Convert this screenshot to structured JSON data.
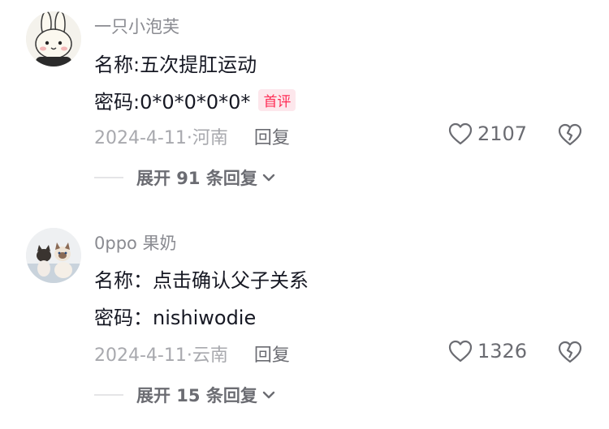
{
  "comments": [
    {
      "username": "一只小泡芙",
      "line1": "名称:五次提肛运动",
      "line2": "密码:0*0*0*0*0*",
      "badge": "首评",
      "meta": "2024-4-11·河南",
      "reply_label": "回复",
      "likes": "2107",
      "expand_label": "展开 91 条回复",
      "avatar_icon": "bunny-avatar-icon"
    },
    {
      "username": "0ppo 果奶",
      "line1": "名称：点击确认父子关系",
      "line2": "密码：nishiwodie",
      "meta": "2024-4-11·云南",
      "reply_label": "回复",
      "likes": "1326",
      "expand_label": "展开 15 条回复",
      "avatar_icon": "cats-avatar-icon"
    }
  ],
  "colors": {
    "text": "#161823",
    "secondary": "#8a8b91",
    "accent": "#fe2c55"
  }
}
